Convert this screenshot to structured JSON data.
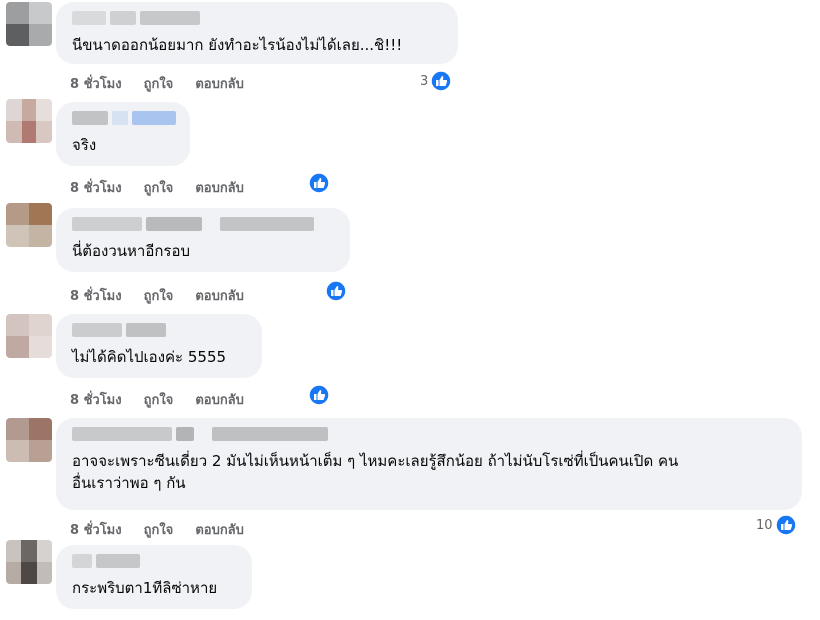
{
  "comments": [
    {
      "text": "นีขนาดออกน้อยมาก ยังทำอะไรน้องไม่ได้เลย...ชิ!!!",
      "time": "8 ชั่วโมง",
      "like": "ถูกใจ",
      "reply": "ตอบกลับ",
      "reactions": "3"
    },
    {
      "text": "จริง",
      "time": "8 ชั่วโมง",
      "like": "ถูกใจ",
      "reply": "ตอบกลับ",
      "reactions": ""
    },
    {
      "text": "นี่ต้องวนหาอีกรอบ",
      "time": "8 ชั่วโมง",
      "like": "ถูกใจ",
      "reply": "ตอบกลับ",
      "reactions": ""
    },
    {
      "text": "ไม่ได้คิดไปเองค่ะ 5555",
      "time": "8 ชั่วโมง",
      "like": "ถูกใจ",
      "reply": "ตอบกลับ",
      "reactions": ""
    },
    {
      "text": "อาจจะเพราะซีนเดี่ยว 2 มันไม่เห็นหน้าเต็ม ๆ ไหมคะเลยรู้สึกน้อย ถ้าไม่นับโรเซ่ที่เป็นคนเปิด คน",
      "text2": "อื่นเราว่าพอ ๆ กัน",
      "time": "8 ชั่วโมง",
      "like": "ถูกใจ",
      "reply": "ตอบกลับ",
      "reactions": "10"
    },
    {
      "text": "กระพริบตา1ทีลิซ่าหาย"
    }
  ],
  "colors": {
    "like_blue": "#1877f2",
    "bubble": "#f0f2f5",
    "meta": "#65676b"
  }
}
